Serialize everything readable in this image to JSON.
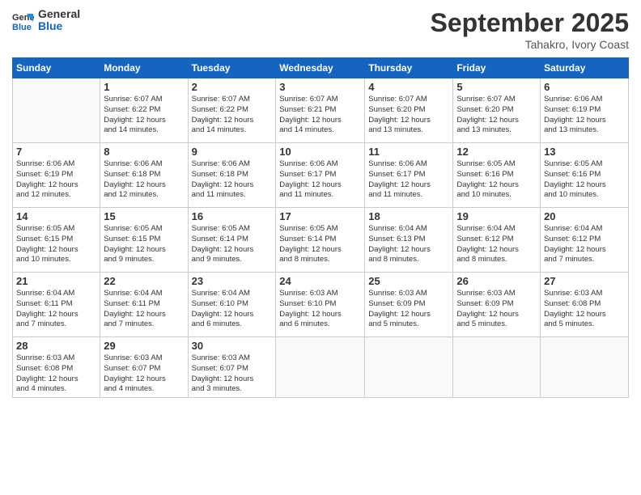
{
  "logo": {
    "general": "General",
    "blue": "Blue"
  },
  "title": "September 2025",
  "location": "Tahakro, Ivory Coast",
  "days_of_week": [
    "Sunday",
    "Monday",
    "Tuesday",
    "Wednesday",
    "Thursday",
    "Friday",
    "Saturday"
  ],
  "weeks": [
    [
      {
        "day": "",
        "info": ""
      },
      {
        "day": "1",
        "info": "Sunrise: 6:07 AM\nSunset: 6:22 PM\nDaylight: 12 hours\nand 14 minutes."
      },
      {
        "day": "2",
        "info": "Sunrise: 6:07 AM\nSunset: 6:22 PM\nDaylight: 12 hours\nand 14 minutes."
      },
      {
        "day": "3",
        "info": "Sunrise: 6:07 AM\nSunset: 6:21 PM\nDaylight: 12 hours\nand 14 minutes."
      },
      {
        "day": "4",
        "info": "Sunrise: 6:07 AM\nSunset: 6:20 PM\nDaylight: 12 hours\nand 13 minutes."
      },
      {
        "day": "5",
        "info": "Sunrise: 6:07 AM\nSunset: 6:20 PM\nDaylight: 12 hours\nand 13 minutes."
      },
      {
        "day": "6",
        "info": "Sunrise: 6:06 AM\nSunset: 6:19 PM\nDaylight: 12 hours\nand 13 minutes."
      }
    ],
    [
      {
        "day": "7",
        "info": "Sunrise: 6:06 AM\nSunset: 6:19 PM\nDaylight: 12 hours\nand 12 minutes."
      },
      {
        "day": "8",
        "info": "Sunrise: 6:06 AM\nSunset: 6:18 PM\nDaylight: 12 hours\nand 12 minutes."
      },
      {
        "day": "9",
        "info": "Sunrise: 6:06 AM\nSunset: 6:18 PM\nDaylight: 12 hours\nand 11 minutes."
      },
      {
        "day": "10",
        "info": "Sunrise: 6:06 AM\nSunset: 6:17 PM\nDaylight: 12 hours\nand 11 minutes."
      },
      {
        "day": "11",
        "info": "Sunrise: 6:06 AM\nSunset: 6:17 PM\nDaylight: 12 hours\nand 11 minutes."
      },
      {
        "day": "12",
        "info": "Sunrise: 6:05 AM\nSunset: 6:16 PM\nDaylight: 12 hours\nand 10 minutes."
      },
      {
        "day": "13",
        "info": "Sunrise: 6:05 AM\nSunset: 6:16 PM\nDaylight: 12 hours\nand 10 minutes."
      }
    ],
    [
      {
        "day": "14",
        "info": "Sunrise: 6:05 AM\nSunset: 6:15 PM\nDaylight: 12 hours\nand 10 minutes."
      },
      {
        "day": "15",
        "info": "Sunrise: 6:05 AM\nSunset: 6:15 PM\nDaylight: 12 hours\nand 9 minutes."
      },
      {
        "day": "16",
        "info": "Sunrise: 6:05 AM\nSunset: 6:14 PM\nDaylight: 12 hours\nand 9 minutes."
      },
      {
        "day": "17",
        "info": "Sunrise: 6:05 AM\nSunset: 6:14 PM\nDaylight: 12 hours\nand 8 minutes."
      },
      {
        "day": "18",
        "info": "Sunrise: 6:04 AM\nSunset: 6:13 PM\nDaylight: 12 hours\nand 8 minutes."
      },
      {
        "day": "19",
        "info": "Sunrise: 6:04 AM\nSunset: 6:12 PM\nDaylight: 12 hours\nand 8 minutes."
      },
      {
        "day": "20",
        "info": "Sunrise: 6:04 AM\nSunset: 6:12 PM\nDaylight: 12 hours\nand 7 minutes."
      }
    ],
    [
      {
        "day": "21",
        "info": "Sunrise: 6:04 AM\nSunset: 6:11 PM\nDaylight: 12 hours\nand 7 minutes."
      },
      {
        "day": "22",
        "info": "Sunrise: 6:04 AM\nSunset: 6:11 PM\nDaylight: 12 hours\nand 7 minutes."
      },
      {
        "day": "23",
        "info": "Sunrise: 6:04 AM\nSunset: 6:10 PM\nDaylight: 12 hours\nand 6 minutes."
      },
      {
        "day": "24",
        "info": "Sunrise: 6:03 AM\nSunset: 6:10 PM\nDaylight: 12 hours\nand 6 minutes."
      },
      {
        "day": "25",
        "info": "Sunrise: 6:03 AM\nSunset: 6:09 PM\nDaylight: 12 hours\nand 5 minutes."
      },
      {
        "day": "26",
        "info": "Sunrise: 6:03 AM\nSunset: 6:09 PM\nDaylight: 12 hours\nand 5 minutes."
      },
      {
        "day": "27",
        "info": "Sunrise: 6:03 AM\nSunset: 6:08 PM\nDaylight: 12 hours\nand 5 minutes."
      }
    ],
    [
      {
        "day": "28",
        "info": "Sunrise: 6:03 AM\nSunset: 6:08 PM\nDaylight: 12 hours\nand 4 minutes."
      },
      {
        "day": "29",
        "info": "Sunrise: 6:03 AM\nSunset: 6:07 PM\nDaylight: 12 hours\nand 4 minutes."
      },
      {
        "day": "30",
        "info": "Sunrise: 6:03 AM\nSunset: 6:07 PM\nDaylight: 12 hours\nand 3 minutes."
      },
      {
        "day": "",
        "info": ""
      },
      {
        "day": "",
        "info": ""
      },
      {
        "day": "",
        "info": ""
      },
      {
        "day": "",
        "info": ""
      }
    ]
  ]
}
